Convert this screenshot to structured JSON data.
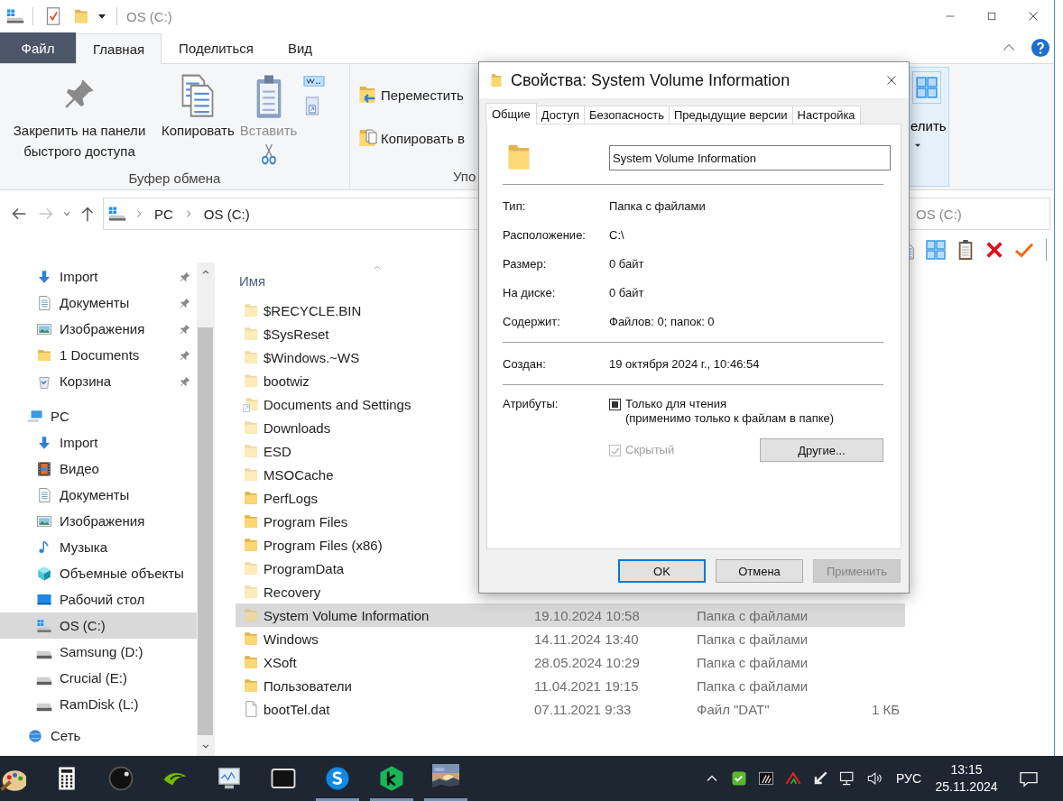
{
  "titlebar": {
    "title": "OS (C:)"
  },
  "menu_tabs": [
    {
      "label": "Файл",
      "kind": "file",
      "selected": false
    },
    {
      "label": "Главная",
      "kind": "tab",
      "selected": true
    },
    {
      "label": "Поделиться",
      "kind": "tab",
      "selected": false
    },
    {
      "label": "Вид",
      "kind": "tab",
      "selected": false
    }
  ],
  "ribbon": {
    "clipboard_group": {
      "label": "Буфер обмена",
      "buttons": [
        {
          "label": "Закрепить на панели быстрого доступа",
          "disabled": false
        },
        {
          "label": "Копировать",
          "disabled": false
        },
        {
          "label": "Вставить",
          "disabled": true
        }
      ]
    },
    "organize_group": {
      "label": "Упо",
      "buttons": [
        "Переместить",
        "Копировать в"
      ]
    },
    "select_group": {
      "label": "елить"
    }
  },
  "address": {
    "path": [
      "PC",
      "OS (C:)"
    ],
    "placeholder": "OS (C:)"
  },
  "navigation": {
    "quick_access": [
      {
        "label": "Import",
        "pinned": true,
        "selected": false
      },
      {
        "label": "Документы",
        "pinned": true,
        "selected": false
      },
      {
        "label": "Изображения",
        "pinned": true,
        "selected": false
      },
      {
        "label": "1 Documents",
        "pinned": true,
        "selected": false
      },
      {
        "label": "Корзина",
        "pinned": true,
        "selected": false
      }
    ],
    "tree": [
      {
        "label": "PC",
        "selected": false,
        "children": [
          {
            "label": "Import",
            "selected": false
          },
          {
            "label": "Видео",
            "selected": false
          },
          {
            "label": "Документы",
            "selected": false
          },
          {
            "label": "Изображения",
            "selected": false
          },
          {
            "label": "Музыка",
            "selected": false
          },
          {
            "label": "Объемные объекты",
            "selected": false
          },
          {
            "label": "Рабочий стол",
            "selected": false
          },
          {
            "label": "OS (C:)",
            "selected": true
          },
          {
            "label": "Samsung (D:)",
            "selected": false
          },
          {
            "label": "Crucial (E:)",
            "selected": false
          },
          {
            "label": "RamDisk (L:)",
            "selected": false
          }
        ]
      },
      {
        "label": "Сеть",
        "selected": false
      }
    ]
  },
  "file_list": {
    "columns": [
      "Имя"
    ],
    "rows": [
      {
        "name": "$RECYCLE.BIN",
        "kind": "folder",
        "hidden": true,
        "selected": false
      },
      {
        "name": "$SysReset",
        "kind": "folder",
        "hidden": true,
        "selected": false
      },
      {
        "name": "$Windows.~WS",
        "kind": "folder",
        "hidden": true,
        "selected": false
      },
      {
        "name": "bootwiz",
        "kind": "folder",
        "hidden": true,
        "selected": false
      },
      {
        "name": "Documents and Settings",
        "kind": "link",
        "hidden": true,
        "selected": false
      },
      {
        "name": "Downloads",
        "kind": "folder",
        "hidden": true,
        "selected": false
      },
      {
        "name": "ESD",
        "kind": "folder",
        "hidden": true,
        "selected": false
      },
      {
        "name": "MSOCache",
        "kind": "folder",
        "hidden": true,
        "selected": false
      },
      {
        "name": "PerfLogs",
        "kind": "folder",
        "hidden": false,
        "selected": false
      },
      {
        "name": "Program Files",
        "kind": "folder",
        "hidden": false,
        "selected": false
      },
      {
        "name": "Program Files (x86)",
        "kind": "folder",
        "hidden": false,
        "selected": false
      },
      {
        "name": "ProgramData",
        "kind": "folder",
        "hidden": true,
        "selected": false
      },
      {
        "name": "Recovery",
        "kind": "folder",
        "hidden": true,
        "selected": false
      },
      {
        "name": "System Volume Information",
        "kind": "folder",
        "hidden": true,
        "selected": true,
        "date": "19.10.2024 10:58",
        "type": "Папка с файлами"
      },
      {
        "name": "Windows",
        "kind": "folder",
        "hidden": false,
        "selected": false,
        "date": "14.11.2024 13:40",
        "type": "Папка с файлами"
      },
      {
        "name": "XSoft",
        "kind": "folder",
        "hidden": false,
        "selected": false,
        "date": "28.05.2024 10:29",
        "type": "Папка с файлами"
      },
      {
        "name": "Пользователи",
        "kind": "folder",
        "hidden": false,
        "selected": false,
        "date": "11.04.2021 19:15",
        "type": "Папка с файлами"
      },
      {
        "name": "bootTel.dat",
        "kind": "file",
        "hidden": false,
        "selected": false,
        "date": "07.11.2021 9:33",
        "type": "Файл \"DAT\"",
        "size": "1 КБ"
      }
    ]
  },
  "dialog": {
    "title": "Свойства: System Volume Information",
    "tabs": [
      {
        "label": "Общие",
        "selected": true
      },
      {
        "label": "Доступ",
        "selected": false
      },
      {
        "label": "Безопасность",
        "selected": false
      },
      {
        "label": "Предыдущие версии",
        "selected": false
      },
      {
        "label": "Настройка",
        "selected": false
      }
    ],
    "name": "System Volume Information",
    "sections": [
      [
        {
          "label": "Тип:",
          "value": "Папка с файлами"
        },
        {
          "label": "Расположение:",
          "value": "C:\\"
        },
        {
          "label": "Размер:",
          "value": "0 байт"
        },
        {
          "label": "На диске:",
          "value": "0 байт"
        },
        {
          "label": "Содержит:",
          "value": "Файлов: 0; папок: 0"
        }
      ],
      [
        {
          "label": "Создан:",
          "value": "19 октября 2024 г., 10:46:54"
        }
      ]
    ],
    "attributes": {
      "label": "Атрибуты:",
      "read_only": {
        "label": "Только для чтения",
        "note": "(применимо только к файлам в папке)",
        "indeterminate": true,
        "disabled": false
      },
      "hidden": {
        "label": "Скрытый",
        "checked": true,
        "disabled": true
      },
      "advanced_button": "Другие..."
    },
    "buttons": [
      {
        "label": "OK",
        "default": true,
        "disabled": false
      },
      {
        "label": "Отмена",
        "default": false,
        "disabled": false
      },
      {
        "label": "Применить",
        "default": false,
        "disabled": true
      }
    ]
  },
  "taskbar": {
    "apps": [
      {
        "running": false
      },
      {
        "running": false
      },
      {
        "running": false
      },
      {
        "running": false
      },
      {
        "running": false
      },
      {
        "running": false
      },
      {
        "running": true
      },
      {
        "running": true
      },
      {
        "running": true
      }
    ],
    "language": "РУС",
    "time": "13:15",
    "date": "25.11.2024"
  }
}
